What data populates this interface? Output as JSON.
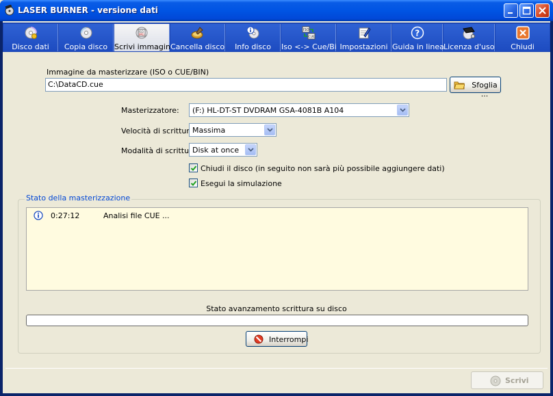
{
  "window": {
    "title": "LASER BURNER - versione dati",
    "minimize_icon": "minimize-icon",
    "maximize_icon": "maximize-icon",
    "close_icon": "close-icon"
  },
  "toolbar": {
    "items": [
      {
        "label": "Disco dati",
        "icon": "data-disc-icon"
      },
      {
        "label": "Copia disco",
        "icon": "copy-disc-icon"
      },
      {
        "label": "Scrivi immagine",
        "icon": "iso-image-icon",
        "active": true
      },
      {
        "label": "Cancella disco",
        "icon": "erase-disc-icon"
      },
      {
        "label": "Info disco",
        "icon": "disc-info-icon"
      },
      {
        "label": "Iso <-> Cue/Bin",
        "icon": "iso-convert-icon"
      },
      {
        "label": "Impostazioni",
        "icon": "settings-icon"
      },
      {
        "label": "Guida in linea",
        "icon": "help-icon"
      },
      {
        "label": "Licenza d'uso",
        "icon": "license-icon"
      },
      {
        "label": "Chiudi",
        "icon": "close-app-icon"
      }
    ]
  },
  "image": {
    "label": "Immagine da masterizzare (ISO o CUE/BIN)",
    "value": "C:\\DataCD.cue",
    "browse_label": "Sfoglia ..."
  },
  "burner": {
    "label": "Masterizzatore:",
    "value": "(F:) HL-DT-ST DVDRAM GSA-4081B A104"
  },
  "speed": {
    "label": "Velocità di scrittura:",
    "value": "Massima"
  },
  "mode": {
    "label": "Modalità di scrittura:",
    "value": "Disk at once"
  },
  "options": {
    "close_disc": {
      "label": "Chiudi il disco (in seguito non sarà più possibile aggiungere dati)",
      "checked": true
    },
    "simulate": {
      "label": "Esegui la simulazione",
      "checked": true
    }
  },
  "status": {
    "group_title": "Stato della masterizzazione",
    "log": [
      {
        "icon": "info-icon",
        "time": "0:27:12",
        "message": "Analisi file CUE ..."
      }
    ],
    "progress_label": "Stato avanzamento scrittura su disco",
    "progress": 0,
    "stop_label": "Interrompi"
  },
  "footer": {
    "write_label": "Scrivi"
  },
  "colors": {
    "titlebar": "#0054e3",
    "toolbar": "#1d4bc0",
    "log_background": "#fffbe0",
    "group_title": "#0046d5"
  }
}
